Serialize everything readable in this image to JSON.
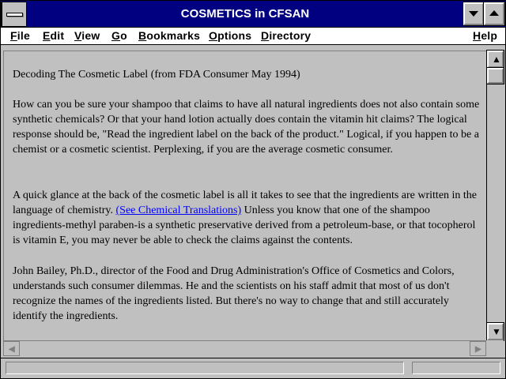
{
  "window": {
    "title": "COSMETICS in CFSAN"
  },
  "menu": {
    "items": [
      "File",
      "Edit",
      "View",
      "Go",
      "Bookmarks",
      "Options",
      "Directory",
      "Help"
    ]
  },
  "document": {
    "heading": "Decoding The Cosmetic Label (from FDA Consumer May 1994)",
    "para1": "How can you be sure your shampoo that claims to have all natural ingredients does not also contain some synthetic chemicals? Or that your hand lotion actually does contain the vitamin hit claims? The logical response should be, \"Read the ingredient label on the back of the product.\" Logical, if you happen to be a chemist or a cosmetic scientist. Perplexing, if you are the average cosmetic consumer.",
    "para2_before": "A quick glance at the back of the cosmetic label is all it takes to see that the ingredients are written in the language of chemistry. ",
    "para2_link": "(See Chemical Translations)",
    "para2_after": " Unless you know that one of the shampoo ingredients-methyl paraben-is a synthetic preservative derived from a petroleum-base, or that tocopherol is vitamin E, you may never be able to check the claims against the contents.",
    "para3": "John Bailey, Ph.D., director of the Food and Drug Administration's Office of Cosmetics and Colors, understands such consumer dilemmas. He and the scientists on his staff admit that most of us don't recognize the names of the ingredients listed. But there's no way to change that and still accurately identify the ingredients."
  },
  "icons": {
    "system_menu": "system-menu-icon",
    "minimize": "minimize-icon",
    "maximize": "maximize-icon",
    "scroll_up": "arrow-up-icon",
    "scroll_down": "arrow-down-icon",
    "scroll_left": "arrow-left-icon",
    "scroll_right": "arrow-right-icon"
  },
  "colors": {
    "titlebar": "#000080",
    "link": "#0000ff",
    "background": "#c0c0c0"
  }
}
